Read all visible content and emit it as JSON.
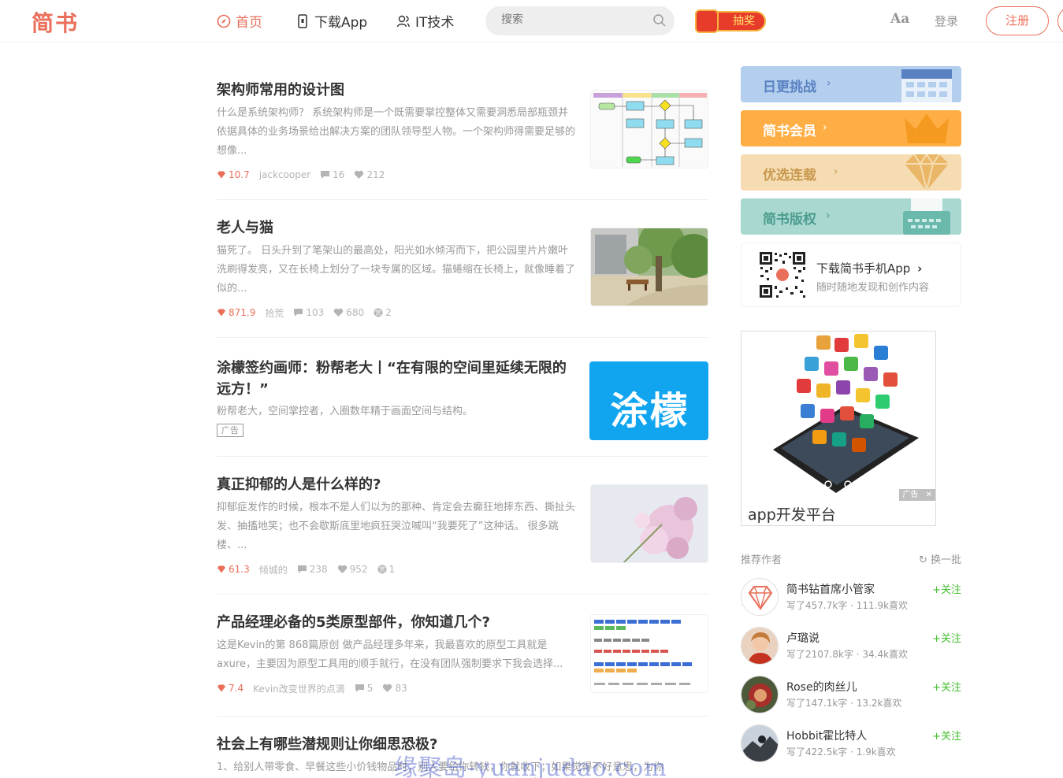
{
  "header": {
    "logo": "简书",
    "nav": [
      {
        "label": "首页",
        "icon": "compass-icon",
        "active": true
      },
      {
        "label": "下载App",
        "icon": "phone-icon",
        "active": false
      },
      {
        "label": "IT技术",
        "icon": "people-icon",
        "active": false
      }
    ],
    "search_placeholder": "搜索",
    "lottery_label": "抽奖",
    "font_toggle": "Aa",
    "login_label": "登录",
    "register_label": "注册"
  },
  "articles": [
    {
      "title": "架构师常用的设计图",
      "abstract": "什么是系统架构师？ 系统架构师是一个既需要掌控整体又需要洞悉局部瓶颈并依据具体的业务场景给出解决方案的团队领导型人物。一个架构师得需要足够的想像...",
      "diamond": "10.7",
      "author": "jackcooper",
      "comments": "16",
      "likes": "212",
      "thumb": "flowchart"
    },
    {
      "title": "老人与猫",
      "abstract": "猫死了。 日头升到了笔架山的最高处，阳光如水倾泻而下，把公园里片片嫩叶洗刷得发亮，又在长椅上划分了一块专属的区域。猫蜷缩在长椅上，就像睡着了似的...",
      "diamond": "871.9",
      "author": "拾荒",
      "comments": "103",
      "likes": "680",
      "rewards": "2",
      "thumb": "park"
    },
    {
      "title": "涂檬签约画师：粉帮老大丨“在有限的空间里延续无限的远方！”",
      "abstract": "粉帮老大，空间掌控者，入圈数年精于画面空间与结构。",
      "ad_label": "广告",
      "thumb_text": "涂檬",
      "thumb": "brand"
    },
    {
      "title": "真正抑郁的人是什么样的?",
      "abstract": "抑郁症发作的时候，根本不是人们以为的那种、肯定会去癫狂地摔东西、撕扯头发、抽搐地笑；也不会歇斯底里地疯狂哭泣喊叫“我要死了”这种话。 很多跳楼、...",
      "diamond": "61.3",
      "author": "倾城的",
      "comments": "238",
      "likes": "952",
      "rewards": "1",
      "thumb": "flower"
    },
    {
      "title": "产品经理必备的5类原型部件，你知道几个?",
      "abstract": "这是Kevin的第 868篇原创 做产品经理多年来，我最喜欢的原型工具就是axure，主要因为原型工具用的顺手就行，在没有团队强制要求下我会选择...",
      "diamond": "7.4",
      "author": "Kevin改变世界的点滴",
      "comments": "5",
      "likes": "83",
      "thumb": "widgets"
    },
    {
      "title": "社会上有哪些潜规则让你细思恐极?",
      "abstract": "1、给别人带零食、早餐这些小价钱物品时，别人要给你转钱，你就收下；如果觉得不好意思，为你"
    }
  ],
  "sidebar": {
    "boards": [
      {
        "label": "日更挑战",
        "color": "#b4cfee",
        "icon": "calendar-icon"
      },
      {
        "label": "简书会员",
        "color": "#ffae45",
        "icon": "crown-icon"
      },
      {
        "label": "优选连载",
        "color": "#f6dcb2",
        "icon": "diamond-icon"
      },
      {
        "label": "简书版权",
        "color": "#a8d8cf",
        "icon": "typewriter-icon"
      }
    ],
    "download": {
      "title": "下载简书手机App",
      "subtitle": "随时随地发现和创作内容"
    },
    "ad": {
      "caption": "app开发平台",
      "mark": "广告"
    },
    "recommend": {
      "title": "推荐作者",
      "swap_label": "换一批",
      "authors": [
        {
          "name": "简书钻首席小管家",
          "stats": "写了457.7k字 · 111.9k喜欢",
          "follow": "+关注"
        },
        {
          "name": "卢璐说",
          "stats": "写了2107.8k字 · 34.4k喜欢",
          "follow": "+关注"
        },
        {
          "name": "Rose的肉丝儿",
          "stats": "写了147.1k字 · 13.2k喜欢",
          "follow": "+关注"
        },
        {
          "name": "Hobbit霍比特人",
          "stats": "写了422.5k字 · 1.9k喜欢",
          "follow": "+关注"
        }
      ]
    }
  },
  "watermark": "缘聚岛-yuanjudao.com"
}
